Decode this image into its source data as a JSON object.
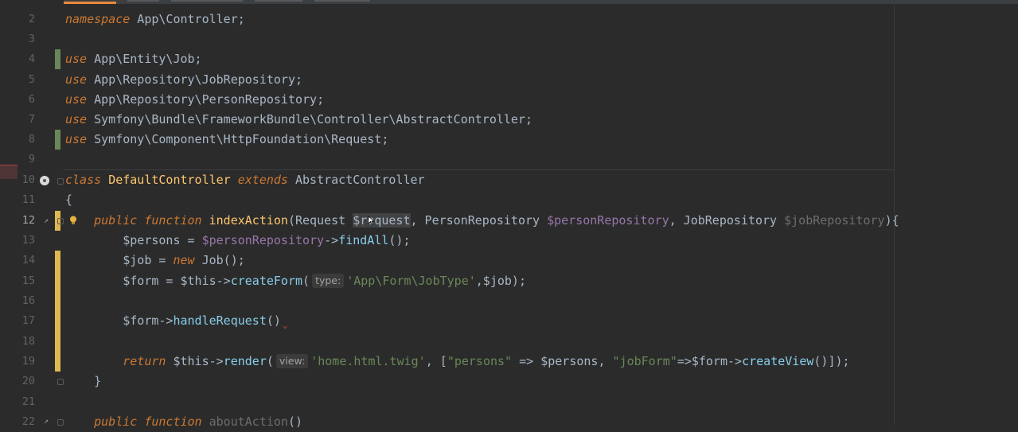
{
  "editor": {
    "current_line": "12",
    "lines": [
      {
        "n": "2"
      },
      {
        "n": "3"
      },
      {
        "n": "4"
      },
      {
        "n": "5"
      },
      {
        "n": "6"
      },
      {
        "n": "7"
      },
      {
        "n": "8"
      },
      {
        "n": "9"
      },
      {
        "n": "10"
      },
      {
        "n": "11"
      },
      {
        "n": "12"
      },
      {
        "n": "13"
      },
      {
        "n": "14"
      },
      {
        "n": "15"
      },
      {
        "n": "16"
      },
      {
        "n": "17"
      },
      {
        "n": "18"
      },
      {
        "n": "19"
      },
      {
        "n": "20"
      },
      {
        "n": "21"
      },
      {
        "n": "22"
      }
    ],
    "code": {
      "l2": {
        "kw": "namespace",
        "rest": " App\\Controller;"
      },
      "l4": {
        "kw": "use",
        "rest": " App\\Entity\\Job;"
      },
      "l5": {
        "kw": "use",
        "rest": " App\\Repository\\JobRepository;"
      },
      "l6": {
        "kw": "use",
        "rest": " App\\Repository\\PersonRepository;"
      },
      "l7": {
        "kw": "use",
        "rest": " Symfony\\Bundle\\FrameworkBundle\\Controller\\AbstractController;"
      },
      "l8": {
        "kw": "use",
        "rest": " Symfony\\Component\\HttpFoundation\\Request;"
      },
      "l10": {
        "kw1": "class",
        "name": "DefaultController",
        "kw2": "extends",
        "parent": "AbstractController"
      },
      "l11": {
        "brace": "{"
      },
      "l12": {
        "kw1": "public",
        "kw2": "function",
        "fn": "indexAction",
        "open": "(Request ",
        "p1": "$request",
        "sep1": ", PersonRepository ",
        "p2": "$personRepository",
        "sep2": ", JobRepository ",
        "p3": "$jobRepository",
        "close": "){"
      },
      "l13": {
        "v1": "$persons",
        "op": " = ",
        "v2": "$personRepository",
        "arrow": "->",
        "m": "findAll",
        "tail": "();"
      },
      "l14": {
        "v1": "$job",
        "op": " = ",
        "kw": "new",
        "tail": " Job();"
      },
      "l15": {
        "v1": "$form",
        "op": " = $this->",
        "m": "createForm",
        "open": "(",
        "hint": "type:",
        "str": "'App\\Form\\JobType'",
        "tail": ",$job);"
      },
      "l17": {
        "v1": "$form",
        "arrow": "->",
        "m": "handleRequest",
        "tail": "()"
      },
      "l19": {
        "kw": "return",
        "pre": " $this->",
        "m": "render",
        "open": "(",
        "hint": "view:",
        "s1": "'home.html.twig'",
        "mid1": ", [",
        "s2": "\"persons\"",
        "mid2": " => $persons, ",
        "s3": "\"jobForm\"",
        "mid3": "=>$form->",
        "m2": "createView",
        "tail": "()]);"
      },
      "l20": {
        "brace": "}"
      },
      "l22": {
        "kw1": "public",
        "kw2": "function",
        "fn": "aboutAction",
        "tail": "()"
      }
    }
  },
  "colors": {
    "background": "#2b2b2b",
    "keyword": "#cc7832",
    "class_name": "#ffc66d",
    "variable": "#9876aa",
    "string": "#6a8759",
    "method_call": "#87ceeb",
    "vcs_added": "#6a8759",
    "vcs_modified": "#e0b850"
  }
}
